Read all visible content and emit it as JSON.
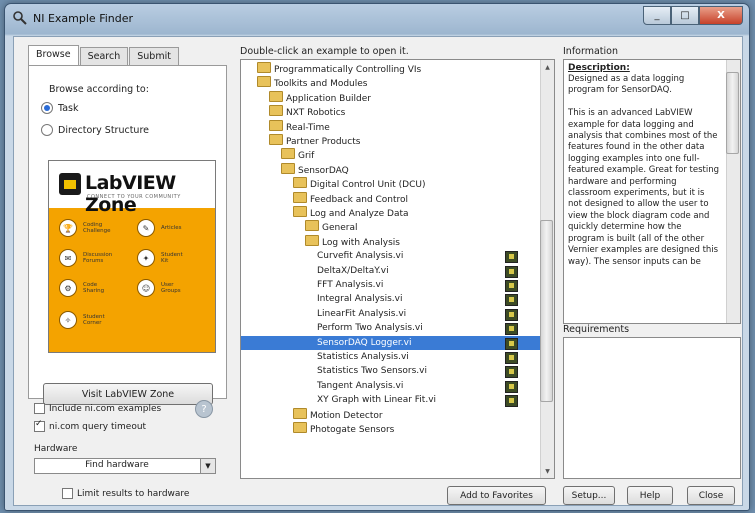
{
  "window": {
    "title": "NI Example Finder",
    "minimize": "_",
    "maximize": "□",
    "close": "X"
  },
  "tabs": [
    {
      "label": "Browse"
    },
    {
      "label": "Search"
    },
    {
      "label": "Submit"
    }
  ],
  "browse": {
    "heading": "Browse according to:",
    "options": [
      {
        "label": "Task",
        "selected": true
      },
      {
        "label": "Directory Structure",
        "selected": false
      }
    ]
  },
  "zone": {
    "title": "LabVIEW Zone",
    "subtitle": "CONNECT TO YOUR COMMUNITY",
    "items": [
      {
        "label": "Coding Challenge",
        "icon": "trophy-icon",
        "glyph": "🏆"
      },
      {
        "label": "Articles",
        "icon": "article-icon",
        "glyph": "✎"
      },
      {
        "label": "Discussion Forums",
        "icon": "forum-icon",
        "glyph": "✉"
      },
      {
        "label": "Student Kit",
        "icon": "student-icon",
        "glyph": "✦"
      },
      {
        "label": "Code Sharing",
        "icon": "code-sharing-icon",
        "glyph": "⚙"
      },
      {
        "label": "User Groups",
        "icon": "user-groups-icon",
        "glyph": "☺"
      },
      {
        "label": "Student Corner",
        "icon": "student-corner-icon",
        "glyph": "✧"
      }
    ]
  },
  "visit_button": "Visit LabVIEW Zone",
  "checkboxes": [
    {
      "label": "Include ni.com examples",
      "checked": false
    },
    {
      "label": "ni.com query timeout",
      "checked": true
    }
  ],
  "help_glyph": "?",
  "hardware": {
    "label": "Hardware",
    "value": "Find hardware",
    "limit_label": "Limit results to hardware",
    "limit_checked": false
  },
  "tree": {
    "instruction": "Double-click an example to open it.",
    "rows": [
      {
        "label": "Programmatically Controlling VIs",
        "indent": 1,
        "kind": "folder"
      },
      {
        "label": "Toolkits and Modules",
        "indent": 1,
        "kind": "folder"
      },
      {
        "label": "Application Builder",
        "indent": 2,
        "kind": "folder"
      },
      {
        "label": "NXT Robotics",
        "indent": 2,
        "kind": "folder"
      },
      {
        "label": "Real-Time",
        "indent": 2,
        "kind": "folder"
      },
      {
        "label": "Partner Products",
        "indent": 2,
        "kind": "folder"
      },
      {
        "label": "Grif",
        "indent": 3,
        "kind": "folder"
      },
      {
        "label": "SensorDAQ",
        "indent": 3,
        "kind": "folder"
      },
      {
        "label": "Digital Control Unit (DCU)",
        "indent": 4,
        "kind": "folder"
      },
      {
        "label": "Feedback and Control",
        "indent": 4,
        "kind": "folder"
      },
      {
        "label": "Log and Analyze Data",
        "indent": 4,
        "kind": "folder"
      },
      {
        "label": "General",
        "indent": 5,
        "kind": "folder"
      },
      {
        "label": "Log with Analysis",
        "indent": 5,
        "kind": "folder"
      },
      {
        "label": "Curvefit Analysis.vi",
        "indent": 6,
        "kind": "vi"
      },
      {
        "label": "DeltaX/DeltaY.vi",
        "indent": 6,
        "kind": "vi"
      },
      {
        "label": "FFT Analysis.vi",
        "indent": 6,
        "kind": "vi"
      },
      {
        "label": "Integral Analysis.vi",
        "indent": 6,
        "kind": "vi"
      },
      {
        "label": "LinearFit Analysis.vi",
        "indent": 6,
        "kind": "vi"
      },
      {
        "label": "Perform Two Analysis.vi",
        "indent": 6,
        "kind": "vi"
      },
      {
        "label": "SensorDAQ Logger.vi",
        "indent": 6,
        "kind": "vi",
        "selected": true
      },
      {
        "label": "Statistics Analysis.vi",
        "indent": 6,
        "kind": "vi"
      },
      {
        "label": "Statistics Two Sensors.vi",
        "indent": 6,
        "kind": "vi"
      },
      {
        "label": "Tangent Analysis.vi",
        "indent": 6,
        "kind": "vi"
      },
      {
        "label": "XY Graph with Linear Fit.vi",
        "indent": 6,
        "kind": "vi"
      },
      {
        "label": "Motion Detector",
        "indent": 4,
        "kind": "folder"
      },
      {
        "label": "Photogate Sensors",
        "indent": 4,
        "kind": "folder"
      }
    ],
    "scroll_up": "▲",
    "scroll_down": "▼"
  },
  "information": {
    "heading": "Information",
    "description_title": "Description:",
    "description": "Designed as a data logging program for SensorDAQ.\n\nThis is an advanced LabVIEW example for data logging and analysis that combines most of the features found in the other data logging examples into one full-featured example.  Great for testing hardware and performing classroom experiments, but it is not designed to allow the user to view the block diagram code and quickly determine how the program is built (all of the other Vernier examples are designed this way).  The sensor inputs can be"
  },
  "requirements": {
    "heading": "Requirements"
  },
  "buttons": {
    "add_favorites": "Add to Favorites",
    "setup": "Setup...",
    "help": "Help",
    "close": "Close"
  }
}
